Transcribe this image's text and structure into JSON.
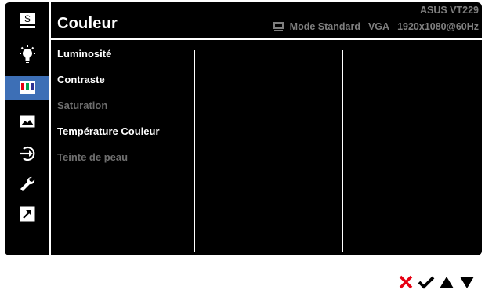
{
  "header": {
    "title": "Couleur",
    "model": "ASUS VT229",
    "mode": "Mode Standard",
    "input": "VGA",
    "resolution": "1920x1080@60Hz"
  },
  "sidebar": {
    "items": [
      {
        "icon": "splendid-icon",
        "label_glyph": "S",
        "active": false
      },
      {
        "icon": "brightness-bulb-icon",
        "active": false
      },
      {
        "icon": "color-bars-icon",
        "active": true
      },
      {
        "icon": "image-icon",
        "active": false
      },
      {
        "icon": "input-select-icon",
        "active": false
      },
      {
        "icon": "wrench-icon",
        "active": false
      },
      {
        "icon": "shortcut-icon",
        "active": false
      }
    ]
  },
  "menu": {
    "items": [
      {
        "label": "Luminosité",
        "enabled": true
      },
      {
        "label": "Contraste",
        "enabled": true
      },
      {
        "label": "Saturation",
        "enabled": false
      },
      {
        "label": "Température Couleur",
        "enabled": true
      },
      {
        "label": "Teinte de peau",
        "enabled": false
      }
    ]
  },
  "nav": {
    "buttons": [
      "close-icon",
      "check-icon",
      "up-arrow-icon",
      "down-arrow-icon"
    ]
  },
  "colors": {
    "active_highlight": "#3d6fb6",
    "close_red": "#e60012",
    "disabled_text": "#6e6e6e",
    "header_text": "#7f7f7f"
  }
}
